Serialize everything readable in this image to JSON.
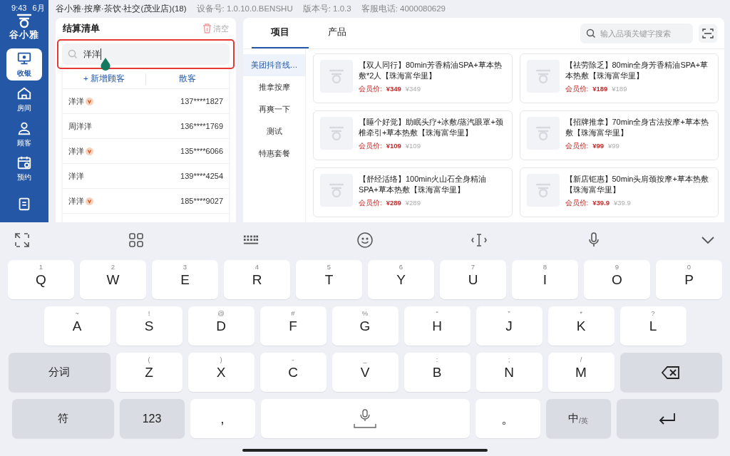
{
  "status_bar": {
    "time": "9:43",
    "date": "6月",
    "store": "谷小雅·按摩·茶饮·社交(茂业店)(18)",
    "device": "设备号: 1.0.10.0.BENSHU",
    "version": "版本号:  1.0.3",
    "hotline": "客服电话:  4000080629"
  },
  "sidebar": {
    "logo_text": "谷小雅",
    "items": [
      {
        "label": "收银",
        "selected": true
      },
      {
        "label": "房间",
        "selected": false
      },
      {
        "label": "顾客",
        "selected": false
      },
      {
        "label": "预约",
        "selected": false
      },
      {
        "selected": false
      }
    ]
  },
  "checkout": {
    "title": "结算清单",
    "clear": "清空",
    "search_value": "洋洋",
    "add_customer": "+ 新增顾客",
    "walk_in": "散客",
    "customers": [
      {
        "name": "洋洋",
        "vip": true,
        "phone": "137****1827"
      },
      {
        "name": "周洋洋",
        "vip": false,
        "phone": "136****1769"
      },
      {
        "name": "洋洋",
        "vip": true,
        "phone": "135****6066"
      },
      {
        "name": "洋洋",
        "vip": false,
        "phone": "139****4254"
      },
      {
        "name": "洋洋",
        "vip": true,
        "phone": "185****9027"
      }
    ]
  },
  "catalog": {
    "tabs": [
      {
        "label": "项目",
        "selected": true
      },
      {
        "label": "产品",
        "selected": false
      }
    ],
    "search_placeholder": "输入品项关键字搜索",
    "categories": [
      {
        "label": "美团抖音线…",
        "selected": true
      },
      {
        "label": "推拿按摩",
        "selected": false
      },
      {
        "label": "再爽一下",
        "selected": false
      },
      {
        "label": "测试",
        "selected": false
      },
      {
        "label": "特惠套餐",
        "selected": false
      }
    ],
    "products": [
      {
        "title": "【双人同行】80min芳香精油SPA+草本热敷*2人【珠海富华里】",
        "member_label": "会员价:",
        "member_price": "¥349",
        "price": "¥349"
      },
      {
        "title": "【祛劳除乏】80min全身芳香精油SPA+草本热敷【珠海富华里】",
        "member_label": "会员价:",
        "member_price": "¥189",
        "price": "¥189"
      },
      {
        "title": "【睡个好觉】助眠头疗+冰敷/蒸汽眼罩+颈椎牵引+草本热敷【珠海富华里】",
        "member_label": "会员价:",
        "member_price": "¥109",
        "price": "¥109"
      },
      {
        "title": "【招牌推拿】70min全身古法按摩+草本热敷【珠海富华里】",
        "member_label": "会员价:",
        "member_price": "¥99",
        "price": "¥99"
      },
      {
        "title": "【舒经活络】100min火山石全身精油SPA+草本热敷【珠海富华里】",
        "member_label": "会员价:",
        "member_price": "¥289",
        "price": "¥289"
      },
      {
        "title": "【新店钜惠】50min头肩颈按摩+草本热敷【珠海富华里】",
        "member_label": "会员价:",
        "member_price": "¥39.9",
        "price": "¥39.9"
      }
    ]
  },
  "keyboard": {
    "key_rows": [
      {
        "keys": [
          {
            "label": "Q",
            "hint": "1",
            "kind": "letter"
          },
          {
            "label": "W",
            "hint": "2",
            "kind": "letter"
          },
          {
            "label": "E",
            "hint": "3",
            "kind": "letter"
          },
          {
            "label": "R",
            "hint": "4",
            "kind": "letter"
          },
          {
            "label": "T",
            "hint": "5",
            "kind": "letter"
          },
          {
            "label": "Y",
            "hint": "6",
            "kind": "letter"
          },
          {
            "label": "U",
            "hint": "7",
            "kind": "letter"
          },
          {
            "label": "I",
            "hint": "8",
            "kind": "letter"
          },
          {
            "label": "O",
            "hint": "9",
            "kind": "letter"
          },
          {
            "label": "P",
            "hint": "0",
            "kind": "letter"
          }
        ]
      },
      {
        "keys": [
          {
            "label": "A",
            "hint": "~",
            "kind": "letter"
          },
          {
            "label": "S",
            "hint": "!",
            "kind": "letter"
          },
          {
            "label": "D",
            "hint": "@",
            "kind": "letter"
          },
          {
            "label": "F",
            "hint": "#",
            "kind": "letter"
          },
          {
            "label": "G",
            "hint": "%",
            "kind": "letter"
          },
          {
            "label": "H",
            "hint": "“",
            "kind": "letter"
          },
          {
            "label": "J",
            "hint": "”",
            "kind": "letter"
          },
          {
            "label": "K",
            "hint": "*",
            "kind": "letter"
          },
          {
            "label": "L",
            "hint": "?",
            "kind": "letter"
          }
        ]
      },
      {
        "keys": [
          {
            "label": "分词",
            "kind": "function"
          },
          {
            "label": "Z",
            "hint": "(",
            "kind": "letter"
          },
          {
            "label": "X",
            "hint": ")",
            "kind": "letter"
          },
          {
            "label": "C",
            "hint": "-",
            "kind": "letter"
          },
          {
            "label": "V",
            "hint": "_",
            "kind": "letter"
          },
          {
            "label": "B",
            "hint": ":",
            "kind": "letter"
          },
          {
            "label": "N",
            "hint": ";",
            "kind": "letter"
          },
          {
            "label": "M",
            "hint": "/",
            "kind": "letter"
          },
          {
            "kind": "delete"
          }
        ]
      },
      {
        "keys": [
          {
            "label": "符",
            "kind": "function"
          },
          {
            "label": "123",
            "kind": "small-function"
          },
          {
            "label": ",",
            "kind": "small"
          },
          {
            "kind": "space"
          },
          {
            "label": "。",
            "kind": "small"
          },
          {
            "label": "中",
            "hint": "/英",
            "kind": "lang"
          },
          {
            "kind": "enter"
          }
        ]
      }
    ]
  }
}
